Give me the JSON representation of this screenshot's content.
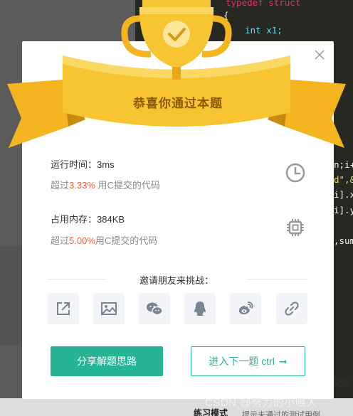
{
  "background": {
    "code_lines": [
      {
        "text": "typedef struct",
        "color": "#f92672"
      },
      {
        "text": "{",
        "color": "#f8f8f2"
      },
      {
        "text": "    int x1;",
        "color": "#66d9ef"
      },
      {
        "text": "n;i++",
        "color": "#f8f8f2"
      },
      {
        "text": "d\",&",
        "color": "#e6db74"
      },
      {
        "text": "i].x",
        "color": "#f8f8f2"
      },
      {
        "text": "i].y",
        "color": "#f8f8f2"
      },
      {
        "text": ",sum",
        "color": "#f8f8f2"
      }
    ],
    "footer_tab": "练习模式",
    "footer_hint": "提示未通过的测试用例",
    "footer_right": "交运",
    "watermark": "CSDN @努力的小鳴人"
  },
  "modal": {
    "title": "恭喜你通过本题",
    "runtime": {
      "label": "运行时间：",
      "value": "3ms",
      "prefix": "超过",
      "percent": "3.33%",
      "suffix": " 用C提交的代码",
      "icon": "clock-icon"
    },
    "memory": {
      "label": "占用内存：",
      "value": "384KB",
      "prefix": "超过",
      "percent": "5.00%",
      "suffix": "用C提交的代码",
      "icon": "chip-icon"
    },
    "share_title": "邀请朋友来挑战：",
    "share_icons": [
      "share-external-icon",
      "image-icon",
      "wechat-icon",
      "qq-icon",
      "weibo-icon",
      "link-icon"
    ],
    "solution_button": "分享解题思路",
    "next_button": "进入下一题 ctrl",
    "next_arrow": "➞"
  },
  "colors": {
    "accent": "#26b594",
    "highlight": "#e8613c",
    "ribbon": "#f7c531",
    "title_text": "#8a5a00"
  }
}
